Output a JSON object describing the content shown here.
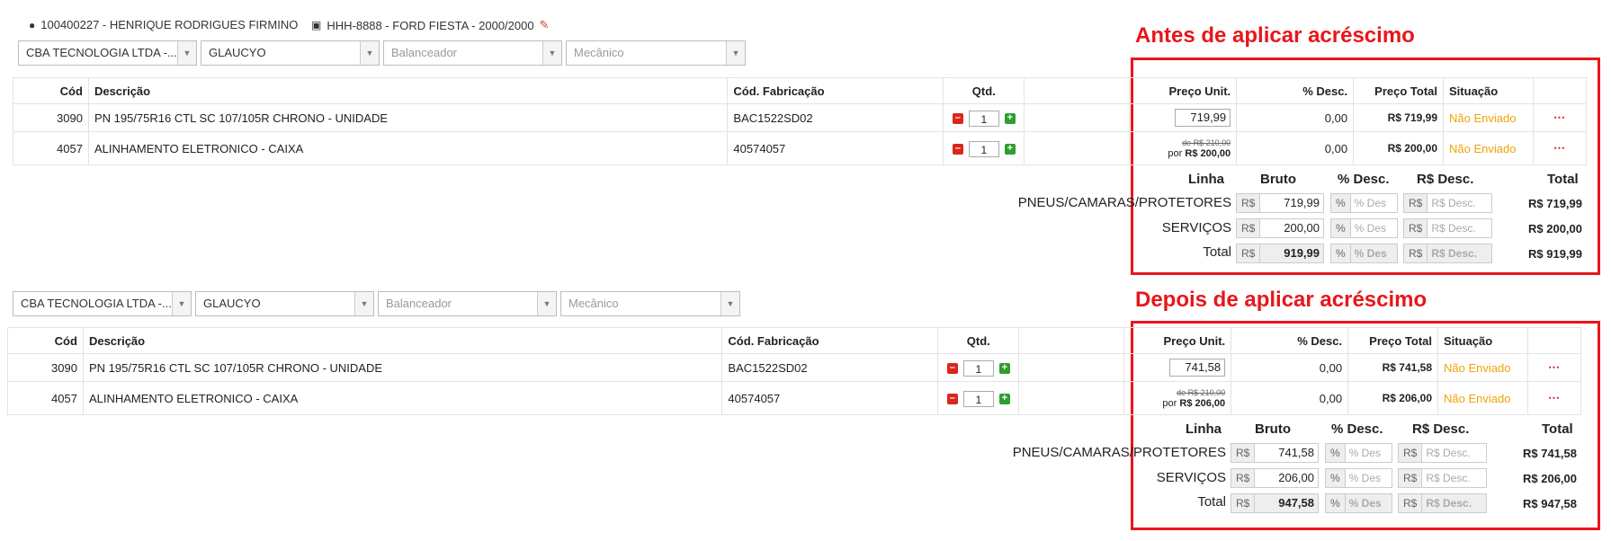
{
  "header": {
    "client": "100400227 - HENRIQUE RODRIGUES FIRMINO",
    "vehicle": "HHH-8888 - FORD FIESTA - 2000/2000"
  },
  "annotations": {
    "before": "Antes de aplicar acréscimo",
    "after": "Depois de aplicar acréscimo"
  },
  "sections": [
    {
      "selects": [
        "CBA TECNOLOGIA LTDA -...",
        "GLAUCYO",
        "Balanceador",
        "Mecânico"
      ],
      "columns": [
        "Cód",
        "Descrição",
        "Cód. Fabricação",
        "Qtd.",
        "Preço Unit.",
        "% Desc.",
        "Preço Total",
        "Situação"
      ],
      "rows": [
        {
          "cod": "3090",
          "desc": "PN 195/75R16 CTL SC 107/105R CHRONO - UNIDADE",
          "fab": "BAC1522SD02",
          "qtd": "1",
          "preco": "719,99",
          "de": "",
          "por": "",
          "desc_pct": "0,00",
          "total": "R$ 719,99",
          "situacao": "Não Enviado"
        },
        {
          "cod": "4057",
          "desc": "ALINHAMENTO ELETRONICO - CAIXA",
          "fab": "40574057",
          "qtd": "1",
          "preco": "",
          "de": "de R$ 210,00",
          "por": "R$ 200,00",
          "desc_pct": "0,00",
          "total": "R$ 200,00",
          "situacao": "Não Enviado"
        }
      ],
      "summary": {
        "headers": [
          "Linha",
          "Bruto",
          "% Desc.",
          "R$ Desc.",
          "Total"
        ],
        "lines": [
          {
            "label": "PNEUS/CAMARAS/PROTETORES",
            "bruto": "719,99",
            "pct": "% Des",
            "rs": "R$ Desc.",
            "total": "R$ 719,99"
          },
          {
            "label": "SERVIÇOS",
            "bruto": "200,00",
            "pct": "% Des",
            "rs": "R$ Desc.",
            "total": "R$ 200,00"
          },
          {
            "label": "Total",
            "bruto": "919,99",
            "pct": "% Des",
            "rs": "R$ Desc.",
            "total": "R$ 919,99"
          }
        ]
      }
    },
    {
      "selects": [
        "CBA TECNOLOGIA LTDA -...",
        "GLAUCYO",
        "Balanceador",
        "Mecânico"
      ],
      "columns": [
        "Cód",
        "Descrição",
        "Cód. Fabricação",
        "Qtd.",
        "Preço Unit.",
        "% Desc.",
        "Preço Total",
        "Situação"
      ],
      "rows": [
        {
          "cod": "3090",
          "desc": "PN 195/75R16 CTL SC 107/105R CHRONO - UNIDADE",
          "fab": "BAC1522SD02",
          "qtd": "1",
          "preco": "741,58",
          "de": "",
          "por": "",
          "desc_pct": "0,00",
          "total": "R$ 741,58",
          "situacao": "Não Enviado"
        },
        {
          "cod": "4057",
          "desc": "ALINHAMENTO ELETRONICO - CAIXA",
          "fab": "40574057",
          "qtd": "1",
          "preco": "",
          "de": "de R$ 210,00",
          "por": "R$ 206,00",
          "desc_pct": "0,00",
          "total": "R$ 206,00",
          "situacao": "Não Enviado"
        }
      ],
      "summary": {
        "headers": [
          "Linha",
          "Bruto",
          "% Desc.",
          "R$ Desc.",
          "Total"
        ],
        "lines": [
          {
            "label": "PNEUS/CAMARAS/PROTETORES",
            "bruto": "741,58",
            "pct": "% Des",
            "rs": "R$ Desc.",
            "total": "R$ 741,58"
          },
          {
            "label": "SERVIÇOS",
            "bruto": "206,00",
            "pct": "% Des",
            "rs": "R$ Desc.",
            "total": "R$ 206,00"
          },
          {
            "label": "Total",
            "bruto": "947,58",
            "pct": "% Des",
            "rs": "R$ Desc.",
            "total": "R$ 947,58"
          }
        ]
      }
    }
  ],
  "ui": {
    "currency_prefix": "R$",
    "percent_prefix": "%",
    "por_label": "por",
    "more_icon": "⋯"
  }
}
